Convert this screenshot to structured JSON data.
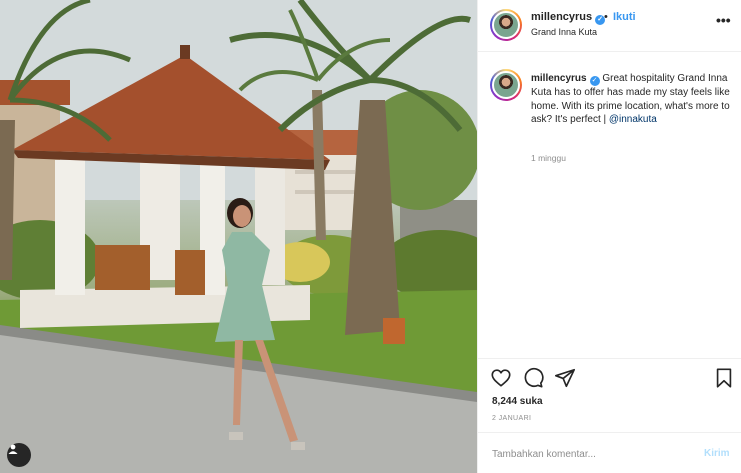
{
  "post": {
    "username": "millencyrus",
    "follow_separator": "•",
    "follow_label": "Ikuti",
    "location": "Grand Inna Kuta",
    "more_glyph": "•••"
  },
  "caption": {
    "username": "millencyrus",
    "text": "Great hospitality Grand Inna Kuta has to offer has made my stay feels like home. With its prime location, what's more to ask? It's perfect | ",
    "mention": "@innakuta",
    "time_ago": "1 minggu"
  },
  "stats": {
    "likes": "8,244 suka",
    "date": "2 JANUARI"
  },
  "comment": {
    "placeholder": "Tambahkan komentar...",
    "send_label": "Kirim"
  },
  "icons": {
    "like": "heart-icon",
    "comment": "speech-bubble-icon",
    "share": "paper-plane-icon",
    "save": "bookmark-icon",
    "verified": "verified-badge-icon",
    "tag": "user-tag-icon"
  },
  "colors": {
    "link": "#3897f0",
    "mention": "#003569",
    "muted": "#8e8e8e",
    "send_disabled": "#b2dffc"
  }
}
